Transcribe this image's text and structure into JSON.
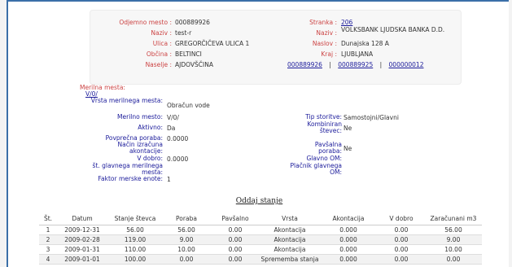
{
  "top": {
    "odjemno_mesto": {
      "label": "Odjemno mesto",
      "value": "000889926"
    },
    "naziv": {
      "label": "Naziv",
      "value": "test-r"
    },
    "ulica": {
      "label": "Ulica",
      "value": "GREGORČIČEVA ULICA 1"
    },
    "obcina": {
      "label": "Občina",
      "value": "BELTINCI"
    },
    "naselje": {
      "label": "Naselje",
      "value": "AJDOVŠČINA"
    },
    "stranka": {
      "label": "Stranka",
      "value": "206"
    },
    "naziv_stranke": {
      "label": "Naziv",
      "value": "VOLKSBANK LJUDSKA BANKA D.D."
    },
    "naslov": {
      "label": "Naslov",
      "value": "Dunajska 128 A"
    },
    "kraj": {
      "label": "Kraj",
      "value": "LJUBLJANA"
    },
    "links": [
      "000889926",
      "000889925",
      "000000012"
    ]
  },
  "merilna_mesta": {
    "heading": "Merilna mesta:",
    "link": "V/0/",
    "left": [
      {
        "label": "Vrsta merilnega mesta:",
        "value": "Obračun vode"
      },
      {
        "label": "Merilno mesto:",
        "value": "V/0/"
      },
      {
        "label": "Aktivno:",
        "value": "Da"
      },
      {
        "label": "Povprečna poraba:",
        "value": "0.0000"
      },
      {
        "label": "Način izračuna akontacije:",
        "value": ""
      },
      {
        "label": "V dobro:",
        "value": "0.0000"
      },
      {
        "label": "št. glavnega merilnega mesta:",
        "value": ""
      },
      {
        "label": "Faktor merske enote:",
        "value": "1"
      }
    ],
    "right": [
      {
        "label": "Tip storitve:",
        "value": "Samostojni/Glavni"
      },
      {
        "label": "Kombiniran števec:",
        "value": "Ne"
      },
      {
        "label": "Pavšalna poraba:",
        "value": "Ne"
      },
      {
        "label": "Glavno OM:",
        "value": ""
      },
      {
        "label": "Plačnik glavnega OM:",
        "value": ""
      }
    ]
  },
  "oddaj_stanje": "Oddaj stanje",
  "table": {
    "columns": [
      "Št.",
      "Datum",
      "Stanje števca",
      "Poraba",
      "Pavšalno",
      "Vrsta",
      "Akontacija",
      "V dobro",
      "Zaračunani m3"
    ],
    "rows": [
      [
        "1",
        "2009-12-31",
        "56.00",
        "56.00",
        "0.00",
        "Akontacija",
        "0.000",
        "0.00",
        "56.00"
      ],
      [
        "2",
        "2009-02-28",
        "119.00",
        "9.00",
        "0.00",
        "Akontacija",
        "0.000",
        "0.00",
        "9.00"
      ],
      [
        "3",
        "2009-01-31",
        "110.00",
        "10.00",
        "0.00",
        "Akontacija",
        "0.000",
        "0.00",
        "10.00"
      ],
      [
        "4",
        "2009-01-01",
        "100.00",
        "0.00",
        "0.00",
        "Sprememba stanja",
        "0.000",
        "0.00",
        "0.00"
      ]
    ]
  }
}
